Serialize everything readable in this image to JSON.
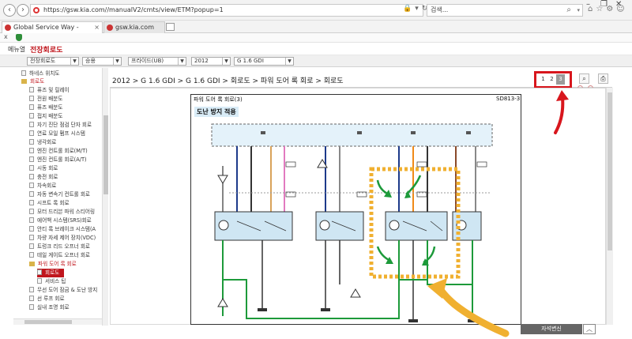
{
  "browser": {
    "url": "https://gsw.kia.com//manualV2/cmts/view/ETM?popup=1",
    "search_placeholder": "검색...",
    "tabs": [
      {
        "label": "Global Service Way - Technic..."
      },
      {
        "label": "gsw.kia.com"
      }
    ]
  },
  "app": {
    "menu_label": "메뉴열",
    "title": "전장회로도"
  },
  "filters": {
    "category": "전장회로도",
    "vehicle_type": "승용",
    "model": "프라이드(UB)",
    "year": "2012",
    "engine": "G 1.6 GDI"
  },
  "sidebar": {
    "items": [
      {
        "label": "하네스 위치도"
      },
      {
        "label": "회로도"
      },
      {
        "label": "퓨즈 및 릴레이"
      },
      {
        "label": "전원 배분도"
      },
      {
        "label": "퓨즈 배분도"
      },
      {
        "label": "접지 배분도"
      },
      {
        "label": "자기 진단 점검 단자 회로"
      },
      {
        "label": "연료 모일 펌프 시스템"
      },
      {
        "label": "냉각회로"
      },
      {
        "label": "엔진 컨트롤 회로(M/T)"
      },
      {
        "label": "엔진 컨트롤 회로(A/T)"
      },
      {
        "label": "시동 회로"
      },
      {
        "label": "충전 회로"
      },
      {
        "label": "차속회로"
      },
      {
        "label": "자동 변속기 컨트롤 회로"
      },
      {
        "label": "시프트 록 회로"
      },
      {
        "label": "모터 드리븐 파워 스티어링"
      },
      {
        "label": "에어백 시스템(SRS)회로"
      },
      {
        "label": "안티 록 브레이크 시스템(A"
      },
      {
        "label": "차량 자세 제어 장치(VDC)"
      },
      {
        "label": "트렁크 리드 오프너 회로"
      },
      {
        "label": "테일 게이트 오프너 회로"
      },
      {
        "label": "파워 도어 록 회로"
      },
      {
        "label": "회로도"
      },
      {
        "label": "서비스 팁"
      },
      {
        "label": "무선 도어 잠금 & 도난 방지"
      },
      {
        "label": "선 루프 회로"
      },
      {
        "label": "실내 조명 회로"
      }
    ]
  },
  "content": {
    "breadcrumb": "2012 > G 1.6 GDI > G 1.6 GDI > 회로도 > 파워 도어 록 회로 > 회로도",
    "pages": [
      "1",
      "2",
      "3"
    ],
    "sheet_title": "파워 도어 록 회로(3)",
    "sheet_code": "SD813-3",
    "sheet_subtitle": "도난 방지 적용",
    "update_button": "자석변신"
  },
  "colors": {
    "accent": "#c0161d",
    "annotation_green": "#1d9a3a",
    "annotation_orange": "#f0b030",
    "highlight_red": "#d8161d"
  }
}
